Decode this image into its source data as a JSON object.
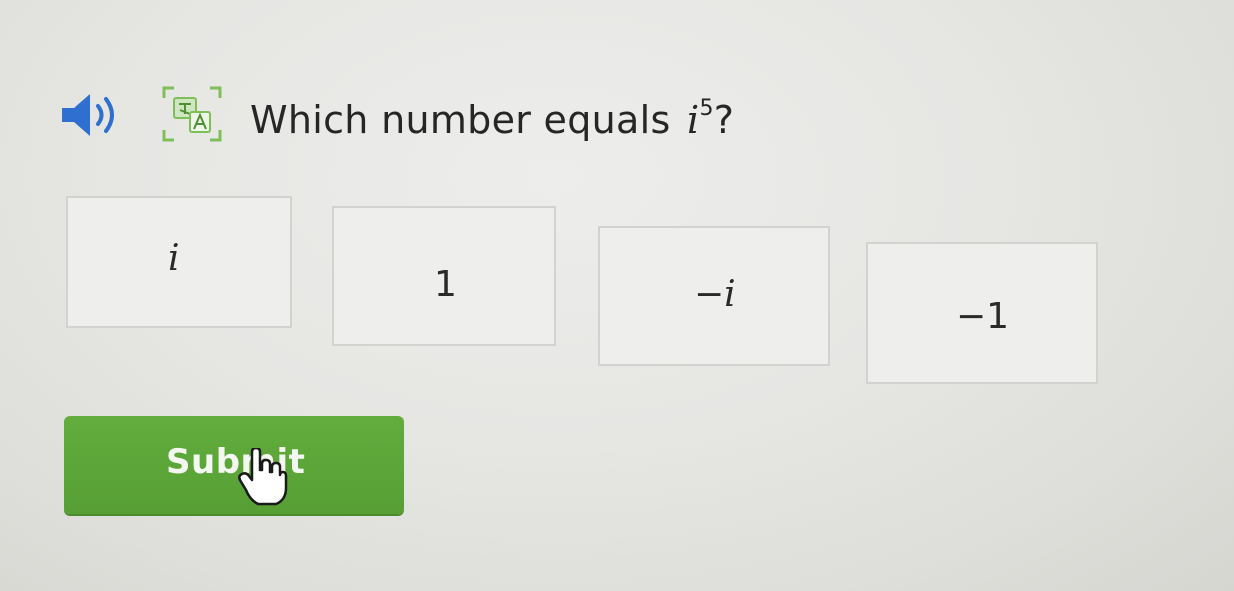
{
  "question": {
    "prefix": "Which number equals ",
    "base": "i",
    "exponent": "5",
    "suffix": "?"
  },
  "toolbar": {
    "audio_icon": "speaker-icon",
    "translate_icon": "translate-icon"
  },
  "choices": [
    {
      "text": "i",
      "italic": true
    },
    {
      "text": "1",
      "italic": false
    },
    {
      "text": "−i",
      "italic": true
    },
    {
      "text": "−1",
      "italic": false
    }
  ],
  "submit": {
    "label": "Submit",
    "color": "#5ba637"
  },
  "cursor": {
    "icon": "hand-pointer-icon"
  },
  "colors": {
    "accent": "#5ba637",
    "icon_green": "#7fbf5a",
    "speaker_blue": "#2f6fcf"
  }
}
